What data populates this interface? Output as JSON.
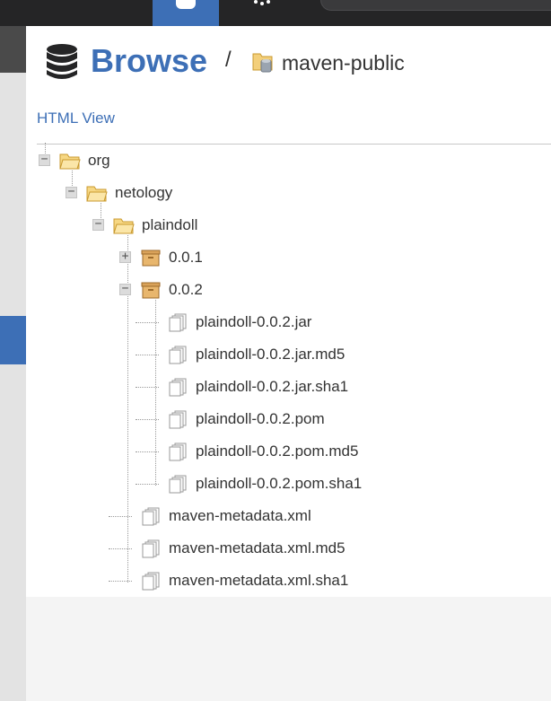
{
  "header": {
    "title": "Browse",
    "separator": "/",
    "repository": "maven-public",
    "html_view_link": "HTML View"
  },
  "icons": {
    "title_icon": "database-icon",
    "repository_icon": "repository-folder-icon",
    "folder_icon": "folder-open-icon",
    "component_icon": "package-box-icon",
    "asset_icon": "file-stack-icon"
  },
  "colors": {
    "accent": "#3d6fb6",
    "topbar": "#252526",
    "text": "#333333"
  },
  "tree": [
    {
      "label": "org",
      "depth": 0,
      "type": "folder",
      "toggle": "−"
    },
    {
      "label": "netology",
      "depth": 1,
      "type": "folder",
      "toggle": "−"
    },
    {
      "label": "plaindoll",
      "depth": 2,
      "type": "folder",
      "toggle": "−"
    },
    {
      "label": "0.0.1",
      "depth": 3,
      "type": "component",
      "toggle": "+"
    },
    {
      "label": "0.0.2",
      "depth": 3,
      "type": "component",
      "toggle": "−"
    },
    {
      "label": "plaindoll-0.0.2.jar",
      "depth": 4,
      "type": "asset"
    },
    {
      "label": "plaindoll-0.0.2.jar.md5",
      "depth": 4,
      "type": "asset"
    },
    {
      "label": "plaindoll-0.0.2.jar.sha1",
      "depth": 4,
      "type": "asset"
    },
    {
      "label": "plaindoll-0.0.2.pom",
      "depth": 4,
      "type": "asset"
    },
    {
      "label": "plaindoll-0.0.2.pom.md5",
      "depth": 4,
      "type": "asset"
    },
    {
      "label": "plaindoll-0.0.2.pom.sha1",
      "depth": 4,
      "type": "asset"
    },
    {
      "label": "maven-metadata.xml",
      "depth": 3,
      "type": "asset"
    },
    {
      "label": "maven-metadata.xml.md5",
      "depth": 3,
      "type": "asset"
    },
    {
      "label": "maven-metadata.xml.sha1",
      "depth": 3,
      "type": "asset"
    }
  ]
}
